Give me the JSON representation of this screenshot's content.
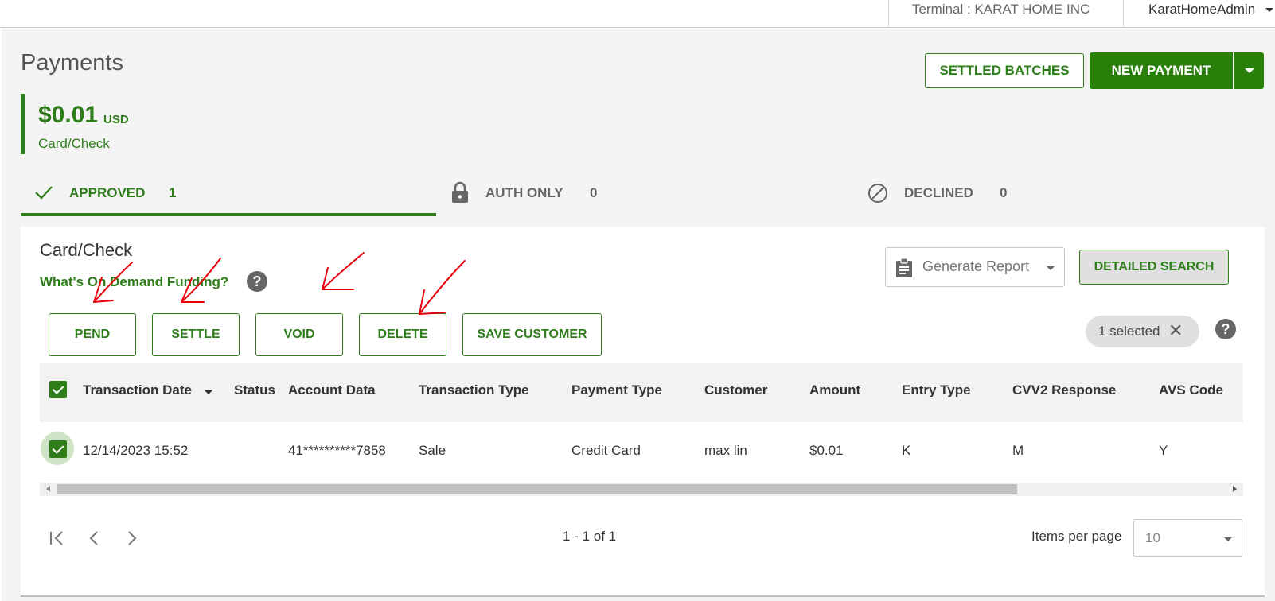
{
  "topbar": {
    "terminal": "Terminal : KARAT HOME INC",
    "user": "KaratHomeAdmin"
  },
  "page": {
    "title": "Payments",
    "summary_amount": "$0.01",
    "summary_currency": "USD",
    "summary_label": "Card/Check",
    "settled_batches_label": "SETTLED BATCHES",
    "new_payment_label": "NEW PAYMENT"
  },
  "tabs": [
    {
      "label": "APPROVED",
      "count": "1"
    },
    {
      "label": "AUTH ONLY",
      "count": "0"
    },
    {
      "label": "DECLINED",
      "count": "0"
    }
  ],
  "card": {
    "title": "Card/Check",
    "funding_link": "What's On Demand Funding?",
    "help_symbol": "?",
    "generate_report_placeholder": "Generate Report",
    "detailed_search_label": "DETAILED SEARCH",
    "actions": [
      "PEND",
      "SETTLE",
      "VOID",
      "DELETE",
      "SAVE CUSTOMER"
    ],
    "selected_text": "1 selected",
    "clear_symbol": "✕"
  },
  "table": {
    "columns": [
      "Transaction Date",
      "Status",
      "Account Data",
      "Transaction Type",
      "Payment Type",
      "Customer",
      "Amount",
      "Entry Type",
      "CVV2 Response",
      "AVS Code"
    ],
    "rows": [
      [
        "12/14/2023 15:52",
        "",
        "41**********7858",
        "Sale",
        "Credit Card",
        "max lin",
        "$0.01",
        "K",
        "M",
        "Y"
      ]
    ]
  },
  "pagination": {
    "range": "1 - 1 of 1",
    "items_per_page_label": "Items per page",
    "items_per_page_value": "10"
  },
  "colors": {
    "brand_green": "#2e7d1a",
    "annotation_red": "#e8000b"
  }
}
